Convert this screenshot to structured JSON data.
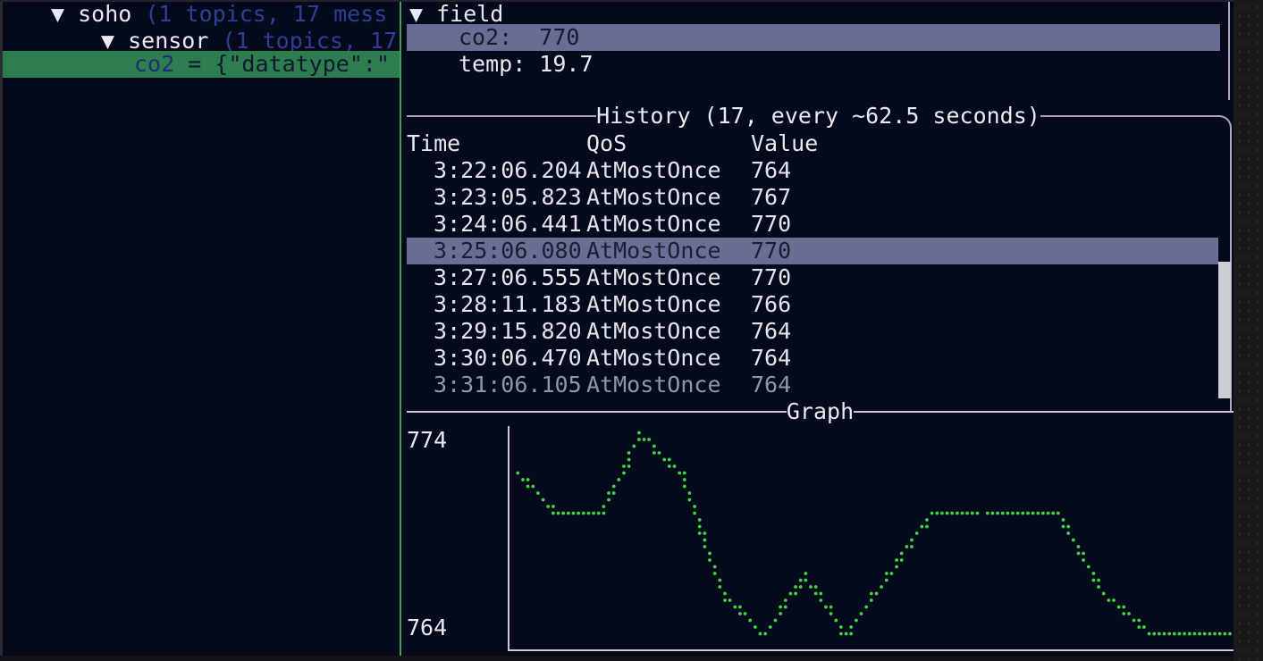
{
  "colors": {
    "terminal_bg": "#040a1c",
    "pane_border_green": "#3f9d62",
    "selection_green": "#2e7d4e",
    "selection_purple": "#6b6e93",
    "dot_green": "#3fd43f",
    "box_border_gray": "#a9abbd",
    "axis_gray": "#c6c9d4",
    "text_white": "#e8eaf2",
    "text_dim_gray": "#9296a4",
    "text_dim_blue": "#2f4093"
  },
  "tree": {
    "rows": [
      {
        "prefix": "▼ soho ",
        "suffix": "(1 topics, 17 mess"
      },
      {
        "prefix": "▼ sensor ",
        "suffix": "(1 topics, 17"
      },
      {
        "label": "co2",
        "payload": " = {\"datatype\":\""
      }
    ]
  },
  "detail": {
    "header": "▼ field",
    "fields": [
      {
        "name": "co2",
        "value": "770",
        "text": "co2:  770",
        "selected": true
      },
      {
        "name": "temp",
        "value": "19.7",
        "text": "temp: 19.7",
        "selected": false
      }
    ]
  },
  "history": {
    "title": "History (17, every ~62.5 seconds)",
    "columns": [
      "Time",
      "QoS",
      "Value"
    ],
    "rows": [
      {
        "time": " 3:22:06.204",
        "qos": "AtMostOnce",
        "value": "764",
        "selected": false,
        "dim": false
      },
      {
        "time": " 3:23:05.823",
        "qos": "AtMostOnce",
        "value": "767",
        "selected": false,
        "dim": false
      },
      {
        "time": " 3:24:06.441",
        "qos": "AtMostOnce",
        "value": "770",
        "selected": false,
        "dim": false
      },
      {
        "time": " 3:25:06.080",
        "qos": "AtMostOnce",
        "value": "770",
        "selected": true,
        "dim": false
      },
      {
        "time": " 3:27:06.555",
        "qos": "AtMostOnce",
        "value": "770",
        "selected": false,
        "dim": false
      },
      {
        "time": " 3:28:11.183",
        "qos": "AtMostOnce",
        "value": "766",
        "selected": false,
        "dim": false
      },
      {
        "time": " 3:29:15.820",
        "qos": "AtMostOnce",
        "value": "764",
        "selected": false,
        "dim": false
      },
      {
        "time": " 3:30:06.470",
        "qos": "AtMostOnce",
        "value": "764",
        "selected": false,
        "dim": false
      },
      {
        "time": " 3:31:06.105",
        "qos": "AtMostOnce",
        "value": "764",
        "selected": false,
        "dim": true
      }
    ]
  },
  "graph": {
    "title": "Graph",
    "y_max_label": "774",
    "y_min_label": "764"
  },
  "chart_data": {
    "type": "line",
    "style": "dotted-terminal",
    "title": "Graph",
    "series_name": "co2",
    "points_count": 17,
    "x_seconds": [
      0,
      57,
      115,
      172,
      230,
      287,
      345,
      402,
      460,
      519,
      580,
      640,
      760,
      825,
      889,
      940,
      1000
    ],
    "values": [
      772,
      770,
      770,
      774,
      772,
      766,
      764,
      767,
      764,
      767,
      770,
      770,
      770,
      766,
      764,
      764,
      764
    ],
    "ylim": [
      764,
      774
    ],
    "y_tick_labels": [
      "774",
      "764"
    ],
    "xlabel": "",
    "ylabel": "",
    "grid": false,
    "legend": "none"
  }
}
